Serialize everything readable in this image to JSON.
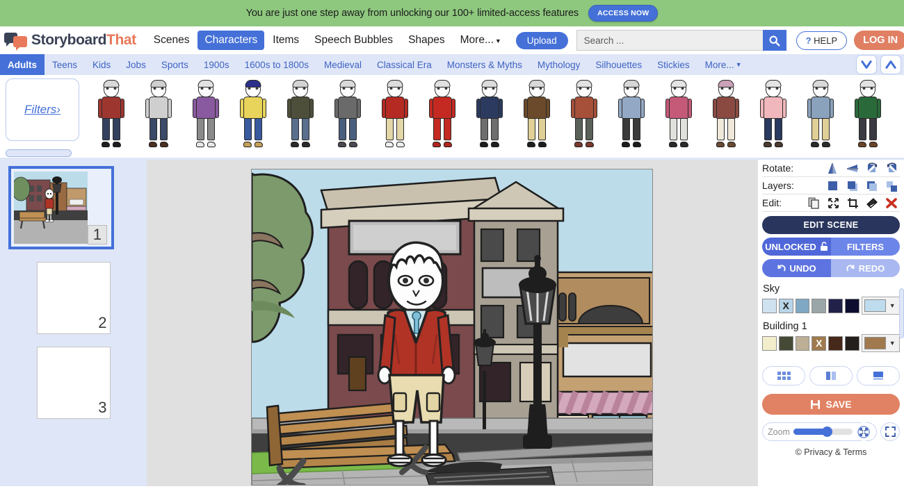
{
  "promo": {
    "text": "You are just one step away from unlocking our 100+ limited-access features",
    "cta": "ACCESS NOW",
    "bg_color": "#8ec87e",
    "cta_color": "#4470d8"
  },
  "brand": {
    "name_part1": "Storyboard",
    "name_part2": "That",
    "color1": "#3a4256",
    "color2": "#e8795a"
  },
  "main_nav": {
    "items": [
      {
        "label": "Scenes",
        "active": false
      },
      {
        "label": "Characters",
        "active": true
      },
      {
        "label": "Items",
        "active": false
      },
      {
        "label": "Speech Bubbles",
        "active": false
      },
      {
        "label": "Shapes",
        "active": false
      },
      {
        "label": "More...",
        "active": false,
        "has_caret": true
      }
    ],
    "upload_label": "Upload",
    "help_label": "HELP",
    "help_glyph": "?",
    "login_label": "LOG IN"
  },
  "search": {
    "value": "",
    "placeholder": "Search ...",
    "icon": "search-icon"
  },
  "sub_nav": {
    "items": [
      {
        "label": "Adults",
        "active": true
      },
      {
        "label": "Teens",
        "active": false
      },
      {
        "label": "Kids",
        "active": false
      },
      {
        "label": "Jobs",
        "active": false
      },
      {
        "label": "Sports",
        "active": false
      },
      {
        "label": "1900s",
        "active": false
      },
      {
        "label": "1600s to 1800s",
        "active": false
      },
      {
        "label": "Medieval",
        "active": false
      },
      {
        "label": "Classical Era",
        "active": false
      },
      {
        "label": "Monsters & Myths",
        "active": false
      },
      {
        "label": "Mythology",
        "active": false
      },
      {
        "label": "Silhouettes",
        "active": false
      },
      {
        "label": "Stickies",
        "active": false
      },
      {
        "label": "More...",
        "active": false,
        "has_caret": true
      }
    ],
    "collapse_icon": "chevron-down-icon",
    "expand_icon": "chevron-up-icon"
  },
  "character_strip": {
    "filters_label": "Filters›",
    "characters": [
      {
        "name": "adult-red-cardigan-jeans",
        "hair": "#d9d9d9",
        "top": "#9e3630",
        "bottom": "#33415e",
        "shoes": "#1e1e1e"
      },
      {
        "name": "adult-grey-hoodie-jeans",
        "hair": "#cfcfcf",
        "top": "#cfcfcf",
        "bottom": "#3a4a68",
        "shoes": "#4a2f22"
      },
      {
        "name": "adult-purple-tank-grey",
        "hair": "#e2e2e2",
        "top": "#8a5aa0",
        "bottom": "#8a8a8a",
        "shoes": "#e8e8e8"
      },
      {
        "name": "adult-yellow-tee-blue-hair",
        "hair": "#2b2f8a",
        "top": "#e8d45a",
        "bottom": "#3a5a9e",
        "shoes": "#c4a05a"
      },
      {
        "name": "adult-olive-jacket-jeans",
        "hair": "#d4d4d4",
        "top": "#4d4f3a",
        "bottom": "#5a6f8e",
        "shoes": "#2a2a2a"
      },
      {
        "name": "adult-grey-jacket-scarf",
        "hair": "#d9d9d9",
        "top": "#6a6a6a",
        "bottom": "#4a5f7e",
        "shoes": "#4a4a52"
      },
      {
        "name": "adult-red-jacket-khaki",
        "hair": "#dcdcdc",
        "top": "#b52a22",
        "bottom": "#e3d7a8",
        "shoes": "#efefef"
      },
      {
        "name": "adult-red-dress",
        "hair": "#e0e0e0",
        "top": "#c42a22",
        "bottom": "#c42a22",
        "shoes": "#b0261f"
      },
      {
        "name": "adult-navy-jacket-grey",
        "hair": "#dcdcdc",
        "top": "#2b3a5e",
        "bottom": "#6e6e6e",
        "shoes": "#1e1e1e"
      },
      {
        "name": "adult-brown-suit-khaki",
        "hair": "#d9d9d9",
        "top": "#6a4a2a",
        "bottom": "#e0cf96",
        "shoes": "#1e1e1e"
      },
      {
        "name": "adult-rust-cardigan-grey",
        "hair": "#e2e2e2",
        "top": "#a6503a",
        "bottom": "#5a6158",
        "shoes": "#7a3a30"
      },
      {
        "name": "adult-blue-shirt-tie",
        "hair": "#d7d7d7",
        "top": "#93a8c4",
        "bottom": "#3a3a3a",
        "shoes": "#1c1c1c"
      },
      {
        "name": "adult-pink-cardigan-white",
        "hair": "#e4e4e4",
        "top": "#c45a78",
        "bottom": "#e0e0dc",
        "shoes": "#2a2a2a"
      },
      {
        "name": "adult-hijab-maroon",
        "hair": "#c9a2b8",
        "top": "#8a4a42",
        "bottom": "#efe8d8",
        "shoes": "#6a4a32"
      },
      {
        "name": "adult-pink-tee-navy-shorts",
        "hair": "#e4e4e4",
        "top": "#f0b8bc",
        "bottom": "#2a3a5e",
        "shoes": "#4a3a30"
      },
      {
        "name": "adult-blue-shirt-khaki",
        "hair": "#d9d9d9",
        "top": "#8aa2bc",
        "bottom": "#e0cf96",
        "shoes": "#2a2a2a"
      },
      {
        "name": "adult-green-top-black-dress",
        "hair": "#e2e2e2",
        "top": "#2a6a3a",
        "bottom": "#3a3a42",
        "shoes": "#6a4428"
      }
    ]
  },
  "scenes_panel": {
    "scenes": [
      {
        "number": "1",
        "selected": true,
        "has_content": true
      },
      {
        "number": "2",
        "selected": false,
        "has_content": false
      },
      {
        "number": "3",
        "selected": false,
        "has_content": false
      }
    ]
  },
  "canvas": {
    "scene_name": "city-street-scene",
    "elements": [
      "sky",
      "tree",
      "building-red-brick",
      "building-tan",
      "building-brown",
      "awning-striped",
      "street-lamp-front",
      "street-lamp-back",
      "bench-wooden",
      "sidewalk",
      "road",
      "storm-drain",
      "character-boy-red-jacket"
    ],
    "colors": {
      "sky": "#b6dcee",
      "tree": "#7d9a6c",
      "road": "#4a4a4a",
      "sidewalk": "#b4b4b4",
      "grass": "#7bba4a",
      "awning": "#d4a8bd",
      "lamp": "#1e1e1e",
      "bench_wood": "#c08f52",
      "char_jacket": "#b03326",
      "char_shorts": "#e8dcb0"
    }
  },
  "tools": {
    "rotate_label": "Rotate:",
    "rotate_icons": [
      "flip-horizontal-icon",
      "flip-vertical-icon",
      "rotate-left-icon",
      "rotate-right-icon"
    ],
    "layers_label": "Layers:",
    "layers_icons": [
      "bring-to-front-icon",
      "bring-forward-icon",
      "send-backward-icon",
      "send-to-back-icon"
    ],
    "edit_label": "Edit:",
    "edit_icons": [
      "duplicate-icon",
      "resize-icon",
      "crop-icon",
      "eraser-icon",
      "delete-icon"
    ],
    "edit_scene_label": "EDIT SCENE",
    "unlocked_label": "UNLOCKED",
    "unlocked_icon": "unlock-icon",
    "filters_label": "FILTERS",
    "undo_label": "UNDO",
    "undo_icon": "undo-arrow-icon",
    "redo_label": "REDO",
    "redo_icon": "redo-arrow-icon",
    "save_label": "SAVE",
    "save_icon": "floppy-disk-icon",
    "zoom_label": "Zoom",
    "zoom_value": 55,
    "fit_icon": "fit-inward-icon",
    "fullscreen_icon": "fullscreen-icon",
    "layout_icons": [
      "grid-layout-icon",
      "column-layout-icon",
      "single-layout-icon"
    ],
    "privacy_label": "© Privacy & Terms"
  },
  "color_sections": [
    {
      "label": "Sky",
      "swatches": [
        {
          "color": "#cfe2f0",
          "selected": false
        },
        {
          "color": "#b8d4e8",
          "selected": true,
          "mark": "X",
          "mark_dark": true
        },
        {
          "color": "#7ea8c4",
          "selected": false
        },
        {
          "color": "#9aa6a8",
          "selected": false
        },
        {
          "color": "#21214a",
          "selected": false
        },
        {
          "color": "#0d0d30",
          "selected": false
        }
      ],
      "current": "#bfdcee"
    },
    {
      "label": "Building 1",
      "swatches": [
        {
          "color": "#f2eecb",
          "selected": false
        },
        {
          "color": "#454a36",
          "selected": false
        },
        {
          "color": "#bdaf96",
          "selected": false
        },
        {
          "color": "#a07a4e",
          "selected": true,
          "mark": "X",
          "mark_dark": false
        },
        {
          "color": "#46291a",
          "selected": false
        },
        {
          "color": "#231f1c",
          "selected": false
        }
      ],
      "current": "#a07a4e"
    }
  ]
}
